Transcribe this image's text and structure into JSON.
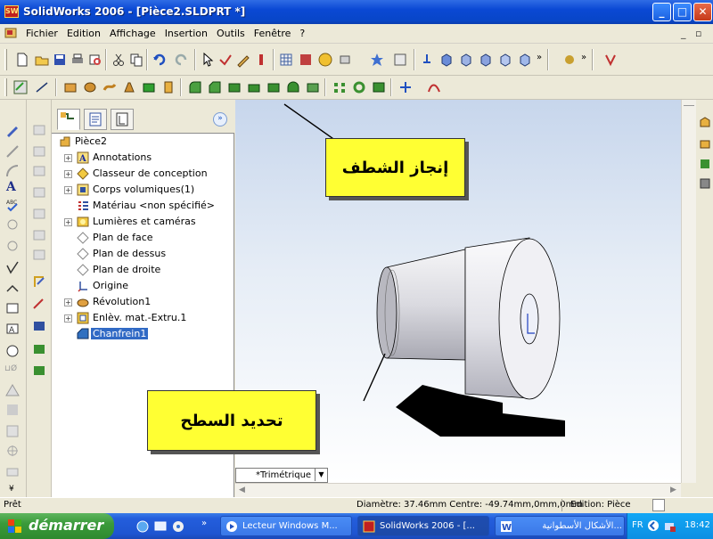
{
  "window": {
    "title": "SolidWorks 2006 - [Pièce2.SLDPRT *]",
    "app_icon_text": "SW"
  },
  "menubar": {
    "items": [
      "Fichier",
      "Edition",
      "Affichage",
      "Insertion",
      "Outils",
      "Fenêtre",
      "?"
    ],
    "mdi_minimize": "_",
    "mdi_restore": "▫"
  },
  "tree": {
    "nodes": [
      {
        "label": "Pièce2"
      },
      {
        "label": "Annotations"
      },
      {
        "label": "Classeur de conception"
      },
      {
        "label": "Corps volumiques(1)"
      },
      {
        "label": "Matériau <non spécifié>"
      },
      {
        "label": "Lumières et caméras"
      },
      {
        "label": "Plan de face"
      },
      {
        "label": "Plan de dessus"
      },
      {
        "label": "Plan de droite"
      },
      {
        "label": "Origine"
      },
      {
        "label": "Révolution1"
      },
      {
        "label": "Enlèv. mat.-Extru.1"
      },
      {
        "label": "Chanfrein1"
      }
    ],
    "expander_label": "»"
  },
  "callouts": {
    "chamfer": "إنجاز الشطف",
    "surface": "تحديد السطح"
  },
  "view": {
    "orientation": "*Trimétrique"
  },
  "status": {
    "left": "Prêt",
    "measure": "Diamètre: 37.46mm Centre: -49.74mm,0mm,0mm",
    "mode": "Edition: Pièce"
  },
  "taskbar": {
    "start_label": "démarrer",
    "tasks": [
      "Lecteur Windows M...",
      "SolidWorks 2006 - [...",
      "...الأشكال الأسطوانية"
    ],
    "lang": "FR",
    "clock": "18:42",
    "more": "»"
  }
}
